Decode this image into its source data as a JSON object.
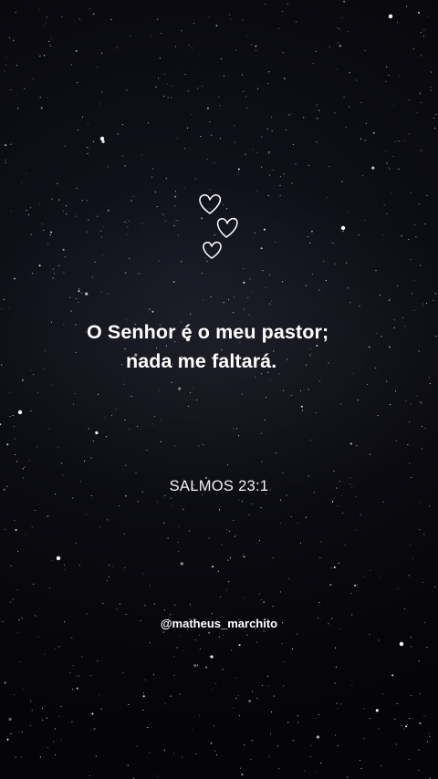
{
  "background": {
    "description_color": "#07070a",
    "star_color": "#ffffff"
  },
  "decoration": {
    "icon": "hearts-doodle-icon",
    "color": "#ffffff"
  },
  "verse": {
    "line1": "O Senhor é o meu pastor;",
    "line2": "nada me faltará."
  },
  "reference": "SALMOS 23:1",
  "author_handle": "@matheus_marchito"
}
